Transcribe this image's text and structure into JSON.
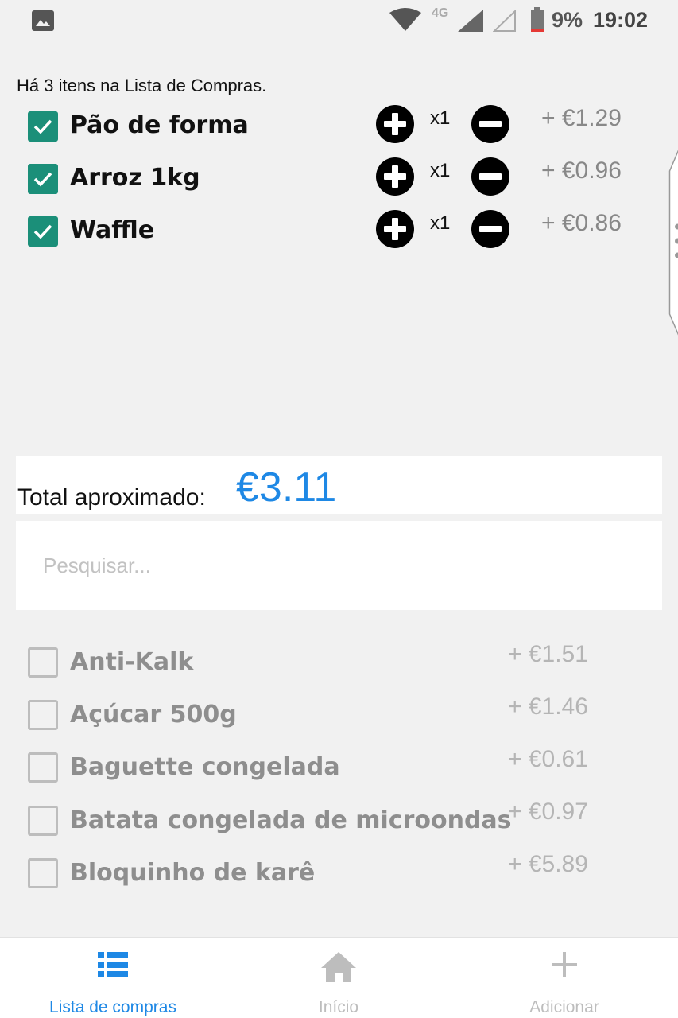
{
  "status_bar": {
    "network": "4G",
    "battery": "9%",
    "time": "19:02"
  },
  "list_count_text": "Há 3 itens na Lista de Compras.",
  "selected_items": [
    {
      "name": "Pão de forma",
      "qty": "x1",
      "price": "+ €1.29",
      "checked": true
    },
    {
      "name": "Arroz 1kg",
      "qty": "x1",
      "price": "+ €0.96",
      "checked": true
    },
    {
      "name": "Waffle",
      "qty": "x1",
      "price": "+ €0.86",
      "checked": true
    }
  ],
  "total": {
    "label": "Total aproximado:",
    "value": "€3.11"
  },
  "search": {
    "placeholder": "Pesquisar..."
  },
  "available_items": [
    {
      "name": "Anti-Kalk",
      "price": "+ €1.51",
      "checked": false
    },
    {
      "name": "Açúcar 500g",
      "price": "+ €1.46",
      "checked": false
    },
    {
      "name": "Baguette congelada",
      "price": "+ €0.61",
      "checked": false
    },
    {
      "name": "Batata congelada de microondas",
      "price": "+ €0.97",
      "checked": false
    },
    {
      "name": "Bloquinho de karê",
      "price": "+ €5.89",
      "checked": false
    }
  ],
  "bottom_nav": [
    {
      "label": "Lista de compras",
      "icon": "list-icon",
      "active": true
    },
    {
      "label": "Início",
      "icon": "home-icon",
      "active": false
    },
    {
      "label": "Adicionar",
      "icon": "plus-icon",
      "active": false
    }
  ],
  "colors": {
    "accent": "#1e88e5",
    "checkbox": "#1b8f79",
    "inactive": "#bdbdbd"
  }
}
